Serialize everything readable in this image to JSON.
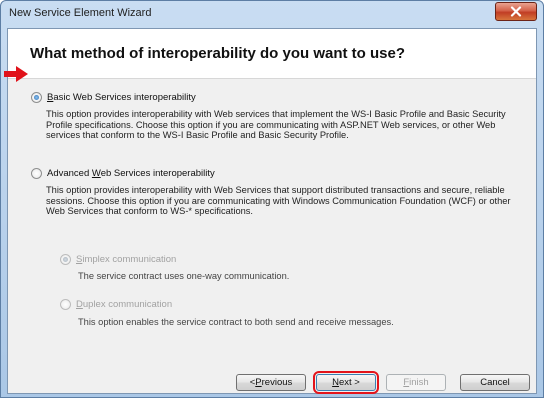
{
  "window": {
    "title": "New Service Element Wizard"
  },
  "header": {
    "title": "What method of interoperability do you want to use?"
  },
  "options": {
    "basic": {
      "label_mnemonic": "B",
      "label_rest": "asic Web Services interoperability",
      "checked": true,
      "description": "This option provides interoperability with Web services that implement the WS-I Basic Profile and Basic Security Profile specifications. Choose this option if you are communicating with ASP.NET Web services, or other Web services that conform to the WS-I Basic Profile and Basic Security Profile."
    },
    "advanced": {
      "label_prefix": "Advanced ",
      "label_mnemonic": "W",
      "label_rest": "eb Services interoperability",
      "checked": false,
      "description": "This option provides interoperability with Web Services that support distributed transactions and secure, reliable sessions. Choose this option if you are communicating with Windows Communication Foundation (WCF) or other Web Services that conform to WS-* specifications."
    },
    "simplex": {
      "label_mnemonic": "S",
      "label_rest": "implex communication",
      "checked": true,
      "enabled": false,
      "description": "The service contract uses one-way communication."
    },
    "duplex": {
      "label_mnemonic": "D",
      "label_rest": "uplex communication",
      "checked": false,
      "enabled": false,
      "description": "This option enables the service contract to both send and receive messages."
    }
  },
  "buttons": {
    "previous": {
      "prefix": "< ",
      "mnemonic": "P",
      "rest": "revious",
      "enabled": true
    },
    "next": {
      "mnemonic": "N",
      "rest": "ext >",
      "enabled": true,
      "highlighted": true
    },
    "finish": {
      "mnemonic": "F",
      "rest": "inish",
      "enabled": false
    },
    "cancel": {
      "label": "Cancel",
      "enabled": true
    }
  },
  "icons": {
    "close": "close-icon",
    "pointer": "red-arrow-icon"
  },
  "colors": {
    "highlight": "#e3141b",
    "arrow": "#e0121a"
  }
}
